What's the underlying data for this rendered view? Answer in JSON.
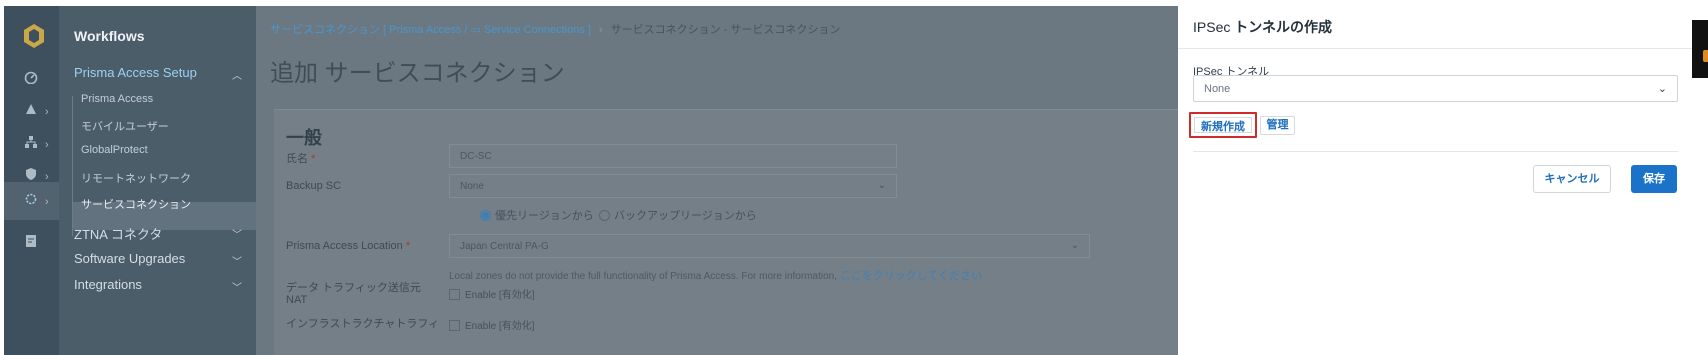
{
  "rail": {
    "icons": [
      "logo-icon",
      "dashboard-icon",
      "alert-icon",
      "network-icon",
      "shield-icon",
      "settings-icon",
      "report-icon"
    ]
  },
  "nav": {
    "title": "Workflows",
    "sections": [
      {
        "label": "Prisma Access Setup",
        "open": true
      },
      {
        "label": "ZTNA コネクタ"
      },
      {
        "label": "Software Upgrades"
      },
      {
        "label": "Integrations"
      }
    ],
    "sub_items": [
      "Prisma Access",
      "モバイルユーザー",
      "GlobalProtect",
      "リモートネットワーク",
      "サービスコネクション"
    ]
  },
  "main": {
    "breadcrumb_link": "サービスコネクション [ Prisma Access / ▭ Service Connections ]",
    "breadcrumb_sep": "›",
    "breadcrumb_current": "サービスコネクション - サービスコネクション",
    "title": "追加 サービスコネクション",
    "section_title": "一般",
    "fields": {
      "name_label": "氏名",
      "name_value": "DC-SC",
      "backup_label": "Backup SC",
      "backup_value": "None",
      "radio_primary": "優先リージョンから",
      "radio_backup": "バックアップリージョンから",
      "location_label": "Prisma Access Location",
      "location_value": "Japan Central PA-G",
      "note_text": "Local zones do not provide the full functionality of Prisma Access. For more information, ",
      "note_link": "ここをクリックしてください",
      "nat_label_line1": "データ トラフィック送信元",
      "nat_label_line2": "NAT",
      "nat_check": "Enable [有効化]",
      "infra_label": "インフラストラクチャトラフィ",
      "infra_check": "Enable [有効化]",
      "required_mark": "*"
    }
  },
  "drawer": {
    "title_prefix": "IPSec ",
    "title_main": "トンネルの作成",
    "field_label": "IPSec トンネル",
    "select_value": "None",
    "new_button": "新規作成",
    "manage_button": "管理",
    "cancel_button": "キャンセル",
    "save_button": "保存"
  },
  "colors": {
    "accent": "#1a73c8",
    "highlight": "#cf2b2b",
    "rail_bg": "#3e4f5d",
    "nav_bg": "#4c5d6a",
    "overlay_bg": "#6b7882"
  }
}
